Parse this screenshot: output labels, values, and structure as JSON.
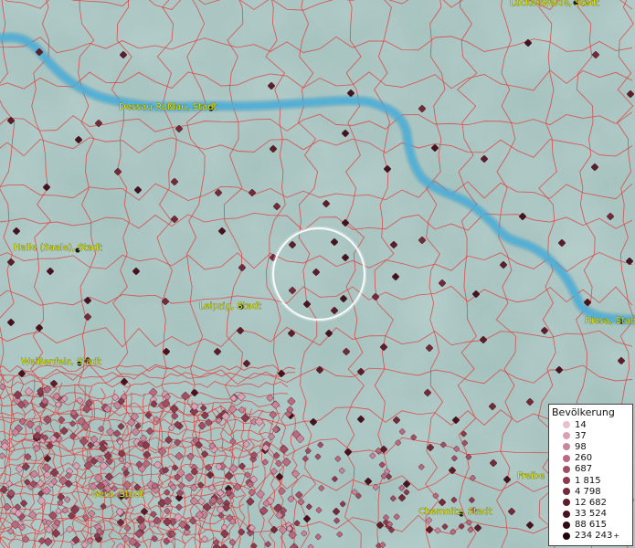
{
  "map": {
    "river_color": "#4aa3c9",
    "boundary_color": "#e03a3a",
    "terrain_color": "#8fb3ae",
    "marker_colors": [
      "#f3dde6",
      "#e8c1cf",
      "#d8a2b4",
      "#c9869a",
      "#b96a7f",
      "#a14f65",
      "#8a3b4e",
      "#732b3a",
      "#5d1e2b",
      "#461420",
      "#320c15",
      "#200608"
    ],
    "cities": [
      {
        "name": "Luckenwalde, Stadt",
        "id": "luckenwalde"
      },
      {
        "name": "Dessau-Roßlau, Stadt",
        "id": "dessau"
      },
      {
        "name": "Halle (Saale), Stadt",
        "id": "halle"
      },
      {
        "name": "Leipzig, Stadt",
        "id": "leipzig"
      },
      {
        "name": "Weißenfels, Stadt",
        "id": "weissenfels"
      },
      {
        "name": "Riesa, Stadt",
        "id": "riesa"
      },
      {
        "name": "Gera, Stadt",
        "id": "gera"
      },
      {
        "name": "Chemnitz, Stadt",
        "id": "chemnitz"
      },
      {
        "name": "Freibe",
        "id": "freiberg"
      }
    ]
  },
  "legend": {
    "title": "Bevölkerung",
    "items": [
      "14",
      "37",
      "98",
      "260",
      "687",
      "1 815",
      "4 798",
      "12 682",
      "33 524",
      "88 615",
      "234 243"
    ],
    "last_suffix": "+"
  }
}
